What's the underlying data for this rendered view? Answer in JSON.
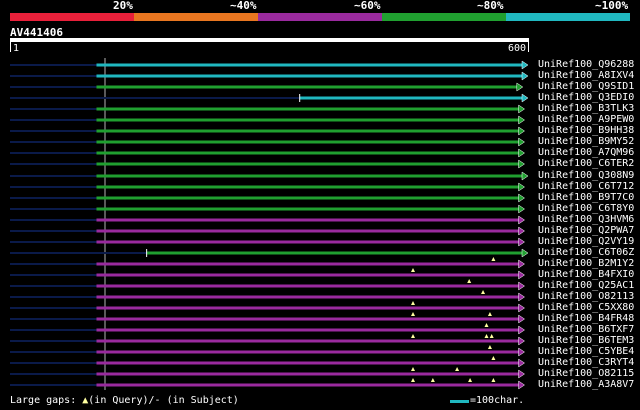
{
  "legend": {
    "segments": [
      {
        "label": "",
        "color": "#e8203a"
      },
      {
        "label": "20%",
        "color": "#e87620"
      },
      {
        "label": "~40%",
        "color": "#9a2a9e"
      },
      {
        "label": "~60%",
        "color": "#20a030"
      },
      {
        "label": "~80%",
        "color": "#20b8c0"
      }
    ],
    "labels": [
      "20%",
      "~40%",
      "~60%",
      "~80%",
      "~100%"
    ]
  },
  "query": {
    "id": "AV441406",
    "scale_start": "1",
    "scale_end": "600",
    "length": 600
  },
  "colors": {
    "cyan": "#20b8c0",
    "green": "#20a030",
    "purple": "#9a2a9e",
    "query_line": "#0a1a4a",
    "gap_marker": "#ffffa0"
  },
  "hits": [
    {
      "name": "UniRef100_Q96288",
      "color": "cyan",
      "start": 101,
      "end": 600,
      "gaps": []
    },
    {
      "name": "UniRef100_A8IXV4",
      "color": "cyan",
      "start": 101,
      "end": 600,
      "gaps": []
    },
    {
      "name": "UniRef100_Q9SID1",
      "color": "green",
      "start": 101,
      "end": 594,
      "gaps": []
    },
    {
      "name": "UniRef100_Q3EDI0",
      "color": "cyan",
      "start": 336,
      "end": 600,
      "gaps": []
    },
    {
      "name": "UniRef100_B3TLK3",
      "color": "green",
      "start": 101,
      "end": 596,
      "gaps": []
    },
    {
      "name": "UniRef100_A9PEW0",
      "color": "green",
      "start": 101,
      "end": 596,
      "gaps": []
    },
    {
      "name": "UniRef100_B9HH38",
      "color": "green",
      "start": 101,
      "end": 596,
      "gaps": []
    },
    {
      "name": "UniRef100_B9MY52",
      "color": "green",
      "start": 101,
      "end": 596,
      "gaps": []
    },
    {
      "name": "UniRef100_A7QM96",
      "color": "green",
      "start": 101,
      "end": 596,
      "gaps": []
    },
    {
      "name": "UniRef100_C6TER2",
      "color": "green",
      "start": 101,
      "end": 596,
      "gaps": []
    },
    {
      "name": "UniRef100_Q308N9",
      "color": "green",
      "start": 101,
      "end": 600,
      "gaps": []
    },
    {
      "name": "UniRef100_C6T712",
      "color": "green",
      "start": 101,
      "end": 596,
      "gaps": []
    },
    {
      "name": "UniRef100_B9T7C0",
      "color": "green",
      "start": 101,
      "end": 596,
      "gaps": []
    },
    {
      "name": "UniRef100_C6T8Y0",
      "color": "green",
      "start": 101,
      "end": 596,
      "gaps": []
    },
    {
      "name": "UniRef100_Q3HVM6",
      "color": "purple",
      "start": 101,
      "end": 596,
      "gaps": []
    },
    {
      "name": "UniRef100_Q2PWA7",
      "color": "purple",
      "start": 101,
      "end": 596,
      "gaps": []
    },
    {
      "name": "UniRef100_Q2VY19",
      "color": "purple",
      "start": 101,
      "end": 596,
      "gaps": []
    },
    {
      "name": "UniRef100_C6T06Z",
      "color": "green",
      "start": 159,
      "end": 600,
      "gaps": []
    },
    {
      "name": "UniRef100_B2M1Y2",
      "color": "purple",
      "start": 101,
      "end": 596,
      "gaps": [
        560
      ]
    },
    {
      "name": "UniRef100_B4FXI0",
      "color": "purple",
      "start": 101,
      "end": 596,
      "gaps": [
        467
      ]
    },
    {
      "name": "UniRef100_Q25AC1",
      "color": "purple",
      "start": 101,
      "end": 596,
      "gaps": [
        532
      ]
    },
    {
      "name": "UniRef100_O82113",
      "color": "purple",
      "start": 101,
      "end": 596,
      "gaps": [
        548
      ]
    },
    {
      "name": "UniRef100_C5XX80",
      "color": "purple",
      "start": 101,
      "end": 596,
      "gaps": [
        467
      ]
    },
    {
      "name": "UniRef100_B4FR48",
      "color": "purple",
      "start": 101,
      "end": 596,
      "gaps": [
        467,
        556
      ]
    },
    {
      "name": "UniRef100_B6TXF7",
      "color": "purple",
      "start": 101,
      "end": 596,
      "gaps": [
        552
      ]
    },
    {
      "name": "UniRef100_B6TEM3",
      "color": "purple",
      "start": 101,
      "end": 596,
      "gaps": [
        467,
        552,
        558
      ]
    },
    {
      "name": "UniRef100_C5YBE4",
      "color": "purple",
      "start": 101,
      "end": 596,
      "gaps": [
        556
      ]
    },
    {
      "name": "UniRef100_C3RYT4",
      "color": "purple",
      "start": 101,
      "end": 596,
      "gaps": [
        560
      ]
    },
    {
      "name": "UniRef100_O82115",
      "color": "purple",
      "start": 101,
      "end": 596,
      "gaps": [
        467,
        518
      ]
    },
    {
      "name": "UniRef100_A3A8V7",
      "color": "purple",
      "start": 101,
      "end": 596,
      "gaps": [
        467,
        490,
        533,
        560
      ]
    }
  ],
  "footer": {
    "large_gaps_label": "Large gaps: ",
    "query_gap_text": "(in Query)/",
    "subject_gap_symbol": "-",
    "subject_gap_text": " (in Subject)",
    "scale_text": "=100char."
  }
}
